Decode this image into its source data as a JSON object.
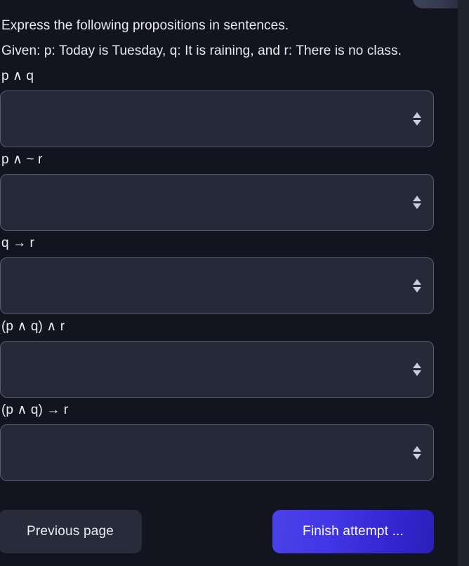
{
  "card": {
    "prompt_line_1": "Express the following propositions in sentences.",
    "prompt_line_2": "Given: p: Today is Tuesday, q: It is raining, and r: There is no class."
  },
  "questions": [
    {
      "label": "p ∧ q",
      "selected": "",
      "placeholder": ""
    },
    {
      "label": "p ∧ ~ r",
      "selected": "",
      "placeholder": ""
    },
    {
      "label": "q → r",
      "selected": "",
      "placeholder": ""
    },
    {
      "label": "(p ∧ q) ∧ r",
      "selected": "",
      "placeholder": ""
    },
    {
      "label": "(p ∧ q) → r",
      "selected": "",
      "placeholder": ""
    }
  ],
  "footer": {
    "previous_label": "Previous page",
    "finish_label": "Finish attempt ..."
  },
  "colors": {
    "page_background": "#20242f",
    "card_background": "#12151f",
    "select_background": "#262a38",
    "select_border": "#555d72",
    "text": "#e9ebf3",
    "previous_button": "#272b3a",
    "finish_button_start": "#4b41e8",
    "finish_button_end": "#2c1fb8",
    "header_chip": "#3e4459"
  }
}
